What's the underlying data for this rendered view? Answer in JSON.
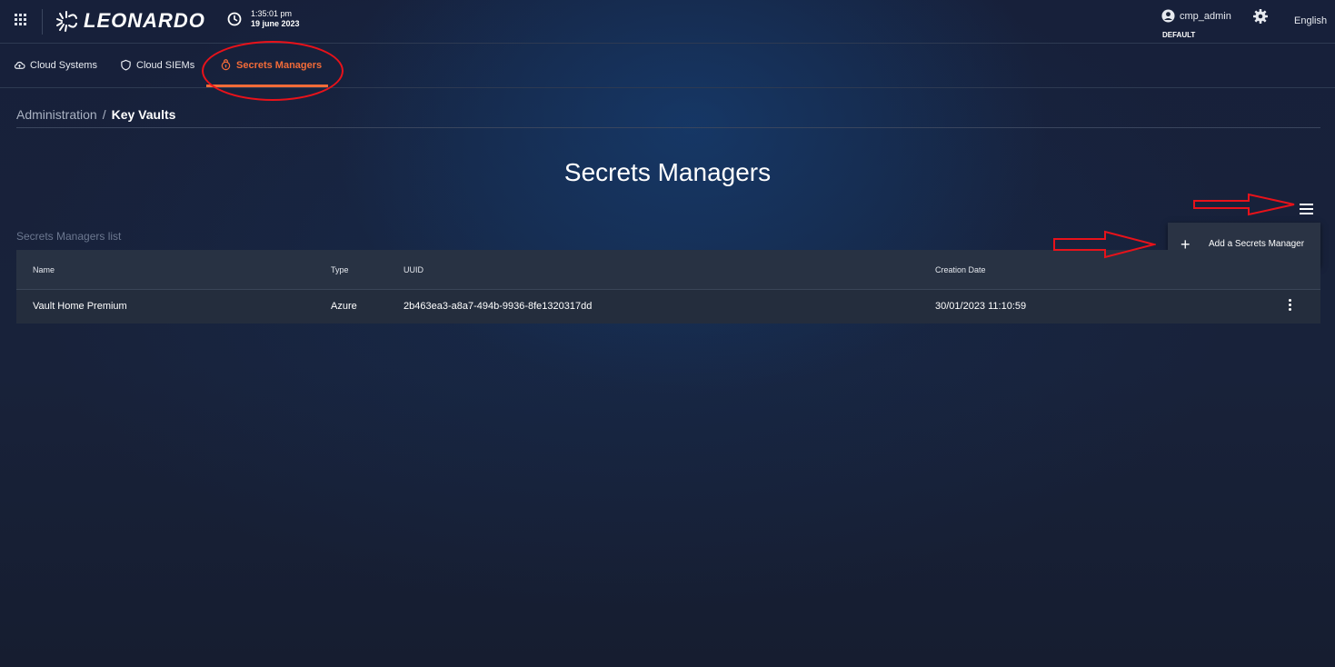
{
  "header": {
    "brand": "LEONARDO",
    "time": "1:35:01 pm",
    "date": "19 june 2023",
    "user": "cmp_admin",
    "tenant": "DEFAULT",
    "language": "English"
  },
  "tabs": [
    {
      "label": "Cloud Systems",
      "icon": "cloud-icon"
    },
    {
      "label": "Cloud SIEMs",
      "icon": "shield-icon"
    },
    {
      "label": "Secrets Managers",
      "icon": "key-lock-icon",
      "active": true
    }
  ],
  "breadcrumb": {
    "parent": "Administration",
    "separator": "/",
    "current": "Key Vaults"
  },
  "page_title": "Secrets Managers",
  "list_label": "Secrets Managers list",
  "table": {
    "columns": [
      "Name",
      "Type",
      "UUID",
      "Creation Date"
    ],
    "rows": [
      {
        "name": "Vault Home Premium",
        "type": "Azure",
        "uuid": "2b463ea3-a8a7-494b-9936-8fe1320317dd",
        "created": "30/01/2023 11:10:59"
      }
    ]
  },
  "menu": {
    "add_label": "Add a Secrets Manager"
  },
  "colors": {
    "accent": "#f26b38",
    "annotation": "#e8121a",
    "background": "#17203a"
  }
}
